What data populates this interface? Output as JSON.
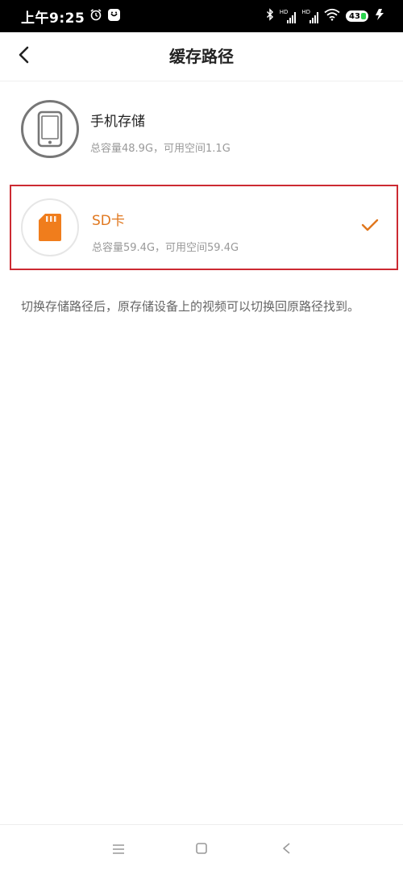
{
  "status_bar": {
    "time": "上午9:25",
    "hd1": "HD",
    "hd2": "HD",
    "battery": "43",
    "icons": [
      "alarm-icon",
      "notification-app-icon",
      "bluetooth-icon",
      "signal-icon",
      "signal-icon",
      "wifi-icon",
      "battery-icon",
      "charging-icon"
    ]
  },
  "header": {
    "title": "缓存路径",
    "back_icon": "chevron-left-icon"
  },
  "storage": [
    {
      "name": "手机存储",
      "detail": "总容量48.9G，可用空间1.1G",
      "icon": "phone-icon",
      "selected": false
    },
    {
      "name": "SD卡",
      "detail": "总容量59.4G，可用空间59.4G",
      "icon": "sd-card-icon",
      "selected": true
    }
  ],
  "tip": "切换存储路径后，原存储设备上的视频可以切换回原路径找到。",
  "colors": {
    "accent": "#e0771e",
    "selection_border": "#cc2a32",
    "sd_card": "#f07d1c"
  },
  "nav_bar": {
    "icons": [
      "menu-icon",
      "home-square-icon",
      "back-triangle-icon"
    ]
  }
}
